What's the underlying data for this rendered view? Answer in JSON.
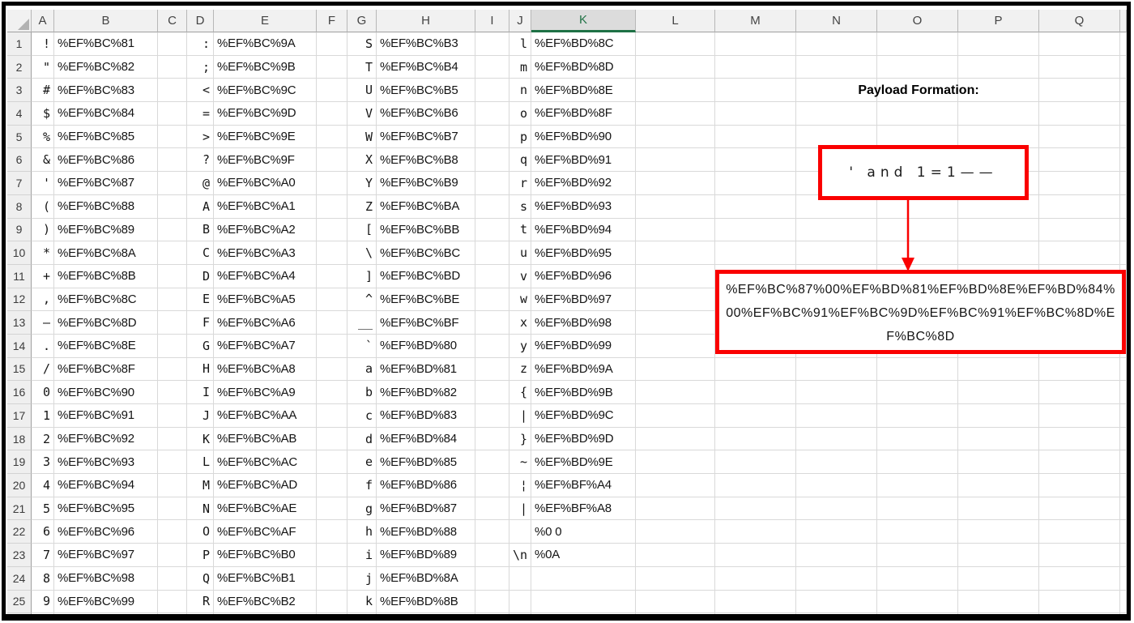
{
  "app": {
    "type": "spreadsheet",
    "description": "Excel sheet mapping characters to fullwidth URL-encoded bytes"
  },
  "colors": {
    "shape_red": "#fa0000",
    "excel_green": "#1e7145",
    "header_bg": "#f1f1f1",
    "selected_header_bg": "#dcdcdc",
    "gridline": "#d9d9d9",
    "frame_black": "#000000"
  },
  "grid": {
    "selected_column": "K",
    "column_headers": [
      "A",
      "B",
      "C",
      "D",
      "E",
      "F",
      "G",
      "H",
      "I",
      "J",
      "K",
      "L",
      "M",
      "N",
      "O",
      "P",
      "Q"
    ],
    "rows": [
      {
        "n": "1",
        "cells": {
          "A": "!",
          "B": "%EF%BC%81",
          "D": ":",
          "E": "%EF%BC%9A",
          "G": "S",
          "H": "%EF%BC%B3",
          "J": "l",
          "K": "%EF%BD%8C"
        }
      },
      {
        "n": "2",
        "cells": {
          "A": "\"",
          "B": "%EF%BC%82",
          "D": ";",
          "E": "%EF%BC%9B",
          "G": "T",
          "H": "%EF%BC%B4",
          "J": "m",
          "K": "%EF%BD%8D"
        }
      },
      {
        "n": "3",
        "cells": {
          "A": "#",
          "B": "%EF%BC%83",
          "D": "<",
          "E": "%EF%BC%9C",
          "G": "U",
          "H": "%EF%BC%B5",
          "J": "n",
          "K": "%EF%BD%8E"
        }
      },
      {
        "n": "4",
        "cells": {
          "A": "$",
          "B": "%EF%BC%84",
          "D": "=",
          "E": "%EF%BC%9D",
          "G": "V",
          "H": "%EF%BC%B6",
          "J": "o",
          "K": "%EF%BD%8F"
        }
      },
      {
        "n": "5",
        "cells": {
          "A": "%",
          "B": "%EF%BC%85",
          "D": ">",
          "E": "%EF%BC%9E",
          "G": "W",
          "H": "%EF%BC%B7",
          "J": "p",
          "K": "%EF%BD%90"
        }
      },
      {
        "n": "6",
        "cells": {
          "A": "&",
          "B": "%EF%BC%86",
          "D": "?",
          "E": "%EF%BC%9F",
          "G": "X",
          "H": "%EF%BC%B8",
          "J": "q",
          "K": "%EF%BD%91"
        }
      },
      {
        "n": "7",
        "cells": {
          "A": "'",
          "B": "%EF%BC%87",
          "D": "@",
          "E": "%EF%BC%A0",
          "G": "Y",
          "H": "%EF%BC%B9",
          "J": "r",
          "K": "%EF%BD%92"
        }
      },
      {
        "n": "8",
        "cells": {
          "A": "(",
          "B": "%EF%BC%88",
          "D": "A",
          "E": "%EF%BC%A1",
          "G": "Z",
          "H": "%EF%BC%BA",
          "J": "s",
          "K": "%EF%BD%93"
        }
      },
      {
        "n": "9",
        "cells": {
          "A": ")",
          "B": "%EF%BC%89",
          "D": "B",
          "E": "%EF%BC%A2",
          "G": "[",
          "H": "%EF%BC%BB",
          "J": "t",
          "K": "%EF%BD%94"
        }
      },
      {
        "n": "10",
        "cells": {
          "A": "*",
          "B": "%EF%BC%8A",
          "D": "C",
          "E": "%EF%BC%A3",
          "G": "\\",
          "H": "%EF%BC%BC",
          "J": "u",
          "K": "%EF%BD%95"
        }
      },
      {
        "n": "11",
        "cells": {
          "A": "+",
          "B": "%EF%BC%8B",
          "D": "D",
          "E": "%EF%BC%A4",
          "G": "]",
          "H": "%EF%BC%BD",
          "J": "v",
          "K": "%EF%BD%96"
        }
      },
      {
        "n": "12",
        "cells": {
          "A": ",",
          "B": "%EF%BC%8C",
          "D": "E",
          "E": "%EF%BC%A5",
          "G": "^",
          "H": "%EF%BC%BE",
          "J": "w",
          "K": "%EF%BD%97"
        }
      },
      {
        "n": "13",
        "cells": {
          "A": "—",
          "B": "%EF%BC%8D",
          "D": "F",
          "E": "%EF%BC%A6",
          "G": "__",
          "H": "%EF%BC%BF",
          "J": "x",
          "K": "%EF%BD%98"
        }
      },
      {
        "n": "14",
        "cells": {
          "A": ".",
          "B": "%EF%BC%8E",
          "D": "G",
          "E": "%EF%BC%A7",
          "G": "`",
          "H": "%EF%BD%80",
          "J": "y",
          "K": "%EF%BD%99"
        }
      },
      {
        "n": "15",
        "cells": {
          "A": "/",
          "B": "%EF%BC%8F",
          "D": "H",
          "E": "%EF%BC%A8",
          "G": "a",
          "H": "%EF%BD%81",
          "J": "z",
          "K": "%EF%BD%9A"
        }
      },
      {
        "n": "16",
        "cells": {
          "A": "0",
          "B": "%EF%BC%90",
          "D": "I",
          "E": "%EF%BC%A9",
          "G": "b",
          "H": "%EF%BD%82",
          "J": "{",
          "K": "%EF%BD%9B"
        }
      },
      {
        "n": "17",
        "cells": {
          "A": "1",
          "B": "%EF%BC%91",
          "D": "J",
          "E": "%EF%BC%AA",
          "G": "c",
          "H": "%EF%BD%83",
          "J": "|",
          "K": "%EF%BD%9C"
        }
      },
      {
        "n": "18",
        "cells": {
          "A": "2",
          "B": "%EF%BC%92",
          "D": "K",
          "E": "%EF%BC%AB",
          "G": "d",
          "H": "%EF%BD%84",
          "J": "}",
          "K": "%EF%BD%9D"
        }
      },
      {
        "n": "19",
        "cells": {
          "A": "3",
          "B": "%EF%BC%93",
          "D": "L",
          "E": "%EF%BC%AC",
          "G": "e",
          "H": "%EF%BD%85",
          "J": "~",
          "K": "%EF%BD%9E"
        }
      },
      {
        "n": "20",
        "cells": {
          "A": "4",
          "B": "%EF%BC%94",
          "D": "M",
          "E": "%EF%BC%AD",
          "G": "f",
          "H": "%EF%BD%86",
          "J": "¦",
          "K": "%EF%BF%A4"
        }
      },
      {
        "n": "21",
        "cells": {
          "A": "5",
          "B": "%EF%BC%95",
          "D": "N",
          "E": "%EF%BC%AE",
          "G": "g",
          "H": "%EF%BD%87",
          "J": "|",
          "K": "%EF%BF%A8"
        }
      },
      {
        "n": "22",
        "cells": {
          "A": "6",
          "B": "%EF%BC%96",
          "D": "O",
          "E": "%EF%BC%AF",
          "G": "h",
          "H": "%EF%BD%88",
          "J": "",
          "K": "%0 0"
        }
      },
      {
        "n": "23",
        "cells": {
          "A": "7",
          "B": "%EF%BC%97",
          "D": "P",
          "E": "%EF%BC%B0",
          "G": "i",
          "H": "%EF%BD%89",
          "J": "\\n",
          "K": "%0A"
        }
      },
      {
        "n": "24",
        "cells": {
          "A": "8",
          "B": "%EF%BC%98",
          "D": "Q",
          "E": "%EF%BC%B1",
          "G": "j",
          "H": "%EF%BD%8A",
          "J": "",
          "K": ""
        }
      },
      {
        "n": "25",
        "cells": {
          "A": "9",
          "B": "%EF%BC%99",
          "D": "R",
          "E": "%EF%BC%B2",
          "G": "k",
          "H": "%EF%BD%8B",
          "J": "",
          "K": ""
        }
      }
    ]
  },
  "payload": {
    "title": "Payload Formation:",
    "input_text": "' and 1=1——",
    "encoded_text": "%EF%BC%87%00%EF%BD%81%EF%BD%8E%EF%BD%84%00%EF%BC%91%EF%BC%9D%EF%BC%91%EF%BC%8D%EF%BC%8D"
  }
}
